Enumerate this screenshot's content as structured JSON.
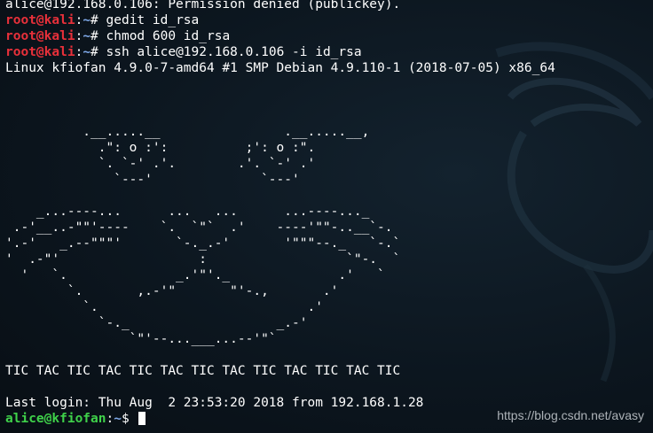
{
  "terminal": {
    "lines": [
      {
        "type": "output",
        "text": "alice@192.168.0.106: Permission denied (publickey)."
      },
      {
        "type": "prompt",
        "user": "root@kali",
        "path": "~",
        "symbol": "#",
        "command": " gedit id_rsa"
      },
      {
        "type": "prompt",
        "user": "root@kali",
        "path": "~",
        "symbol": "#",
        "command": " chmod 600 id_rsa"
      },
      {
        "type": "prompt",
        "user": "root@kali",
        "path": "~",
        "symbol": "#",
        "command": " ssh alice@192.168.0.106 -i id_rsa"
      },
      {
        "type": "output",
        "text": "Linux kfiofan 4.9.0-7-amd64 #1 SMP Debian 4.9.110-1 (2018-07-05) x86_64"
      },
      {
        "type": "output",
        "text": ""
      },
      {
        "type": "output",
        "text": ""
      },
      {
        "type": "output",
        "text": ""
      },
      {
        "type": "output",
        "text": "          .__.....__                .__.....__,"
      },
      {
        "type": "output",
        "text": "            .\": o :':          ;': o :\"."
      },
      {
        "type": "output",
        "text": "            `. `-' .'.        .'. `-' .'"
      },
      {
        "type": "output",
        "text": "              `---'              `---'"
      },
      {
        "type": "output",
        "text": ""
      },
      {
        "type": "output",
        "text": "    _...----...      ...   ...      ...----..._"
      },
      {
        "type": "output",
        "text": " .-'__..-\"\"'----    `.  `\"`  .'    ----'\"\"-..__`-."
      },
      {
        "type": "output",
        "text": "'.-'   _.--\"\"\"'       `-._.-'       '\"\"\"--._   `-.`"
      },
      {
        "type": "output",
        "text": "'  .-\"'                  :                  `\"-.  `"
      },
      {
        "type": "output",
        "text": "  '   `.              _.'\"'._              .'   `"
      },
      {
        "type": "output",
        "text": "        `.       ,.-'\"       \"'-.,       .'"
      },
      {
        "type": "output",
        "text": "          `.                           .'"
      },
      {
        "type": "output",
        "text": "            `-._                   _.-'"
      },
      {
        "type": "output",
        "text": "                `\"'--...___...--'\"`"
      },
      {
        "type": "output",
        "text": ""
      },
      {
        "type": "output",
        "text": "TIC TAC TIC TAC TIC TAC TIC TAC TIC TAC TIC TAC TIC"
      },
      {
        "type": "output",
        "text": ""
      },
      {
        "type": "output",
        "text": "Last login: Thu Aug  2 23:53:20 2018 from 192.168.1.28"
      },
      {
        "type": "prompt",
        "user": "alice@kfiofan",
        "path": "~",
        "symbol": "$",
        "command": " ",
        "cursor": true
      }
    ]
  },
  "watermark": "https://blog.csdn.net/avasy",
  "colors": {
    "root_prompt": "#e8303a",
    "user_prompt": "#3fd14a",
    "path": "#7fa9e8",
    "background": "#0c161f"
  }
}
